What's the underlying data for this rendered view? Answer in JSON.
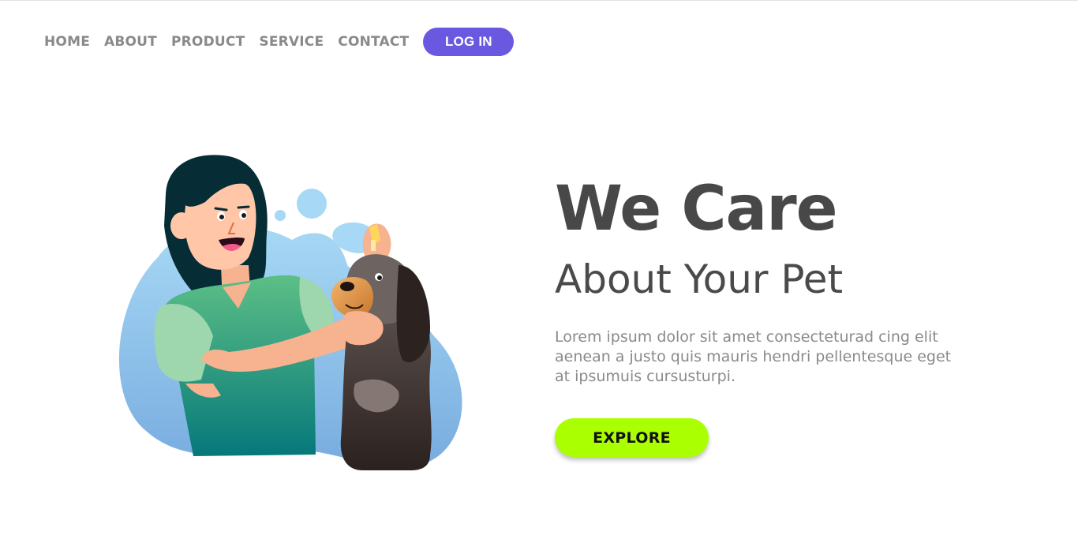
{
  "nav": {
    "links": [
      "HOME",
      "ABOUT",
      "PRODUCT",
      "SERVICE",
      "CONTACT"
    ],
    "login_label": "LOG IN"
  },
  "hero": {
    "title": "We Care",
    "subtitle": "About Your Pet",
    "description": "Lorem ipsum dolor sit amet consecteturad cing elit aenean a justo quis mauris hendri pellentesque eget at ipsumuis cursusturpi.",
    "cta_label": "EXPLORE"
  },
  "colors": {
    "accent": "#6a59e0",
    "cta": "#aaff00",
    "heading": "#484848",
    "muted": "#8a8a8a"
  }
}
